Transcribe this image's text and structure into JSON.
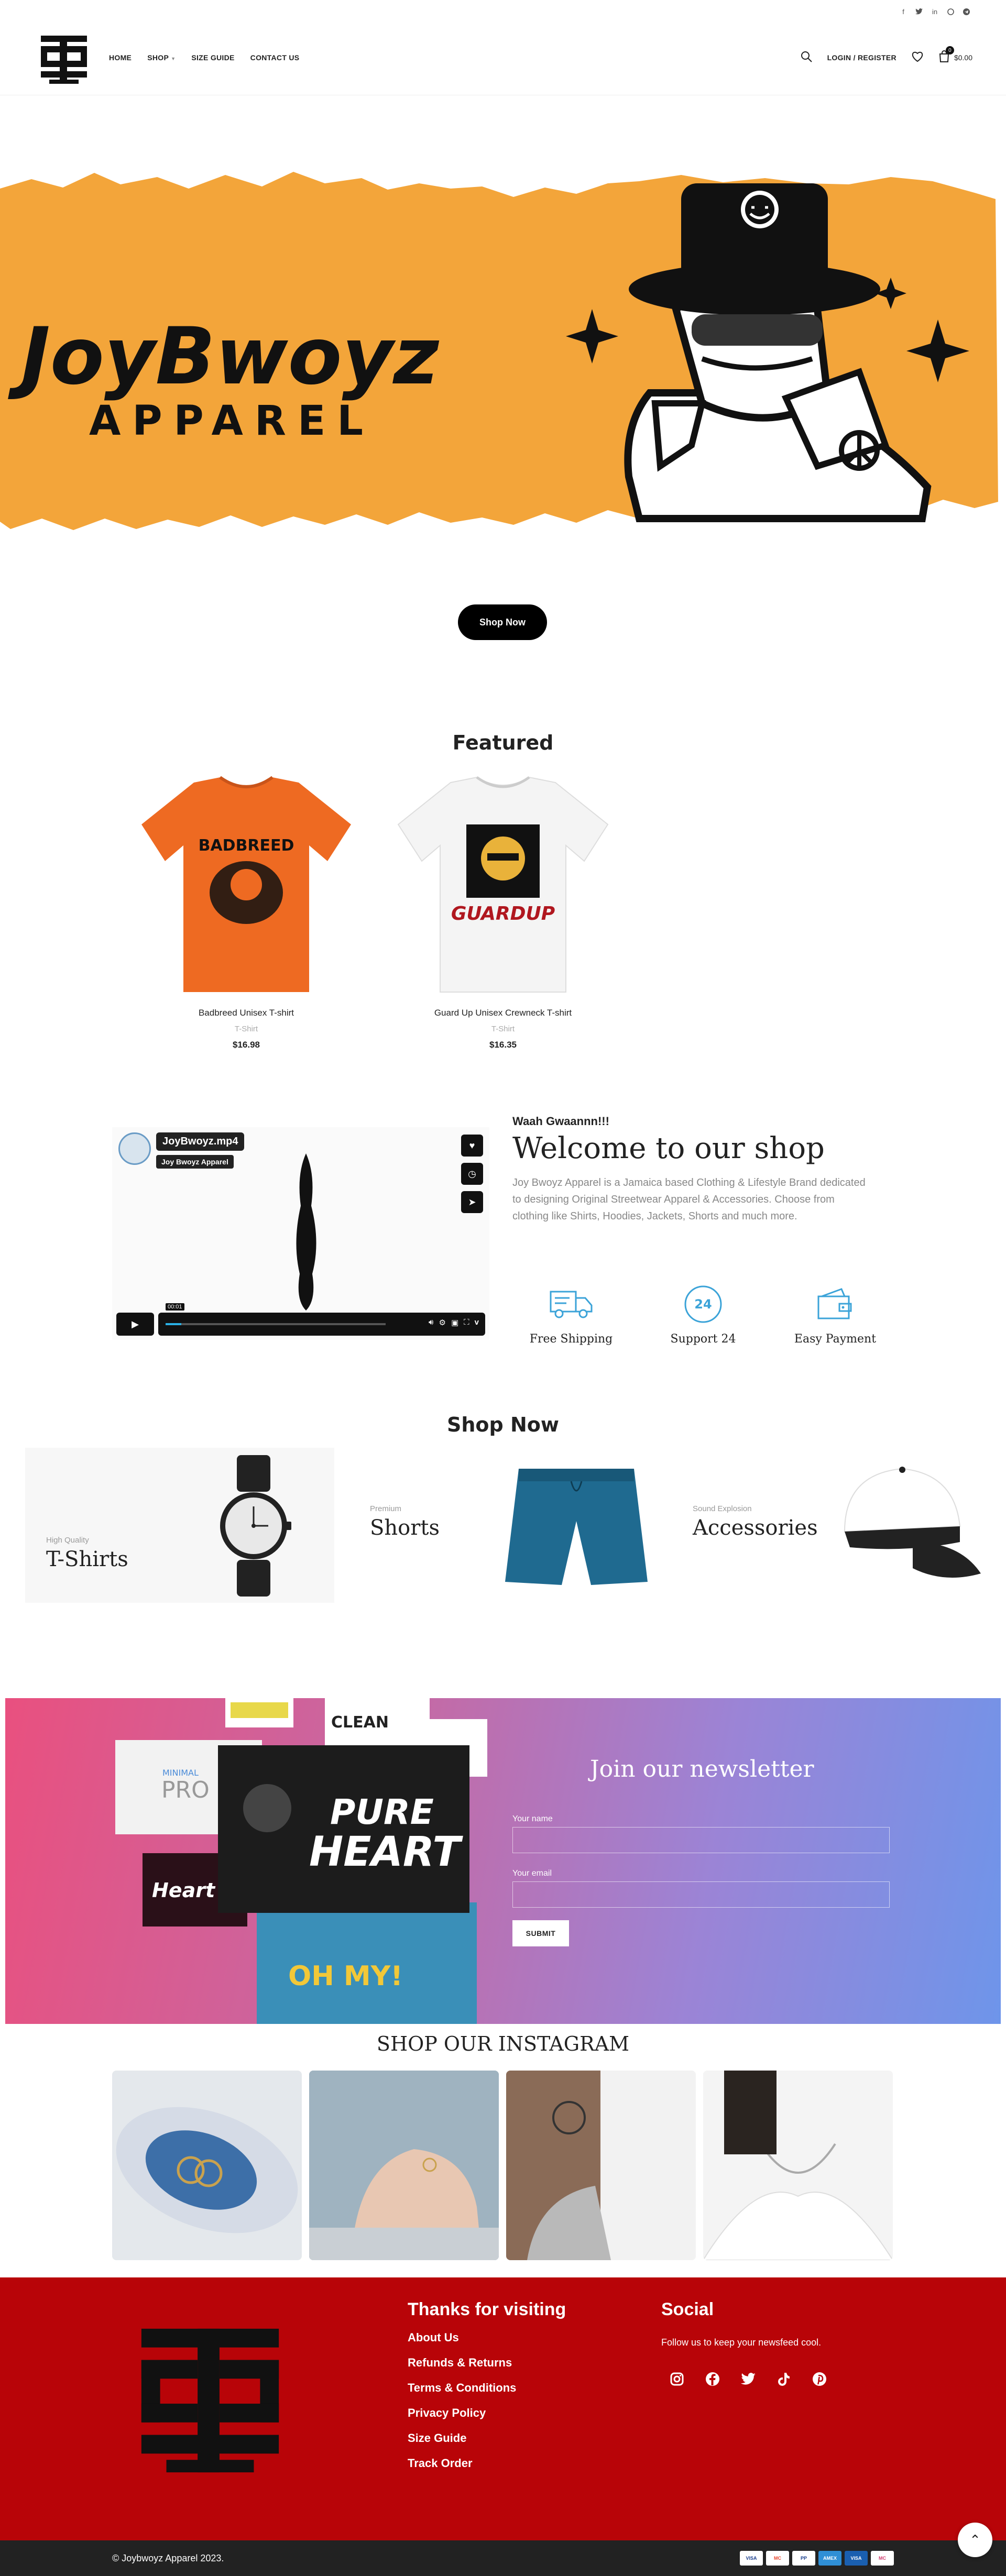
{
  "top_social": [
    "f",
    "t",
    "in",
    "w",
    "tg"
  ],
  "header": {
    "nav": [
      {
        "label": "HOME"
      },
      {
        "label": "SHOP"
      },
      {
        "label": "SIZE GUIDE"
      },
      {
        "label": "CONTACT US"
      }
    ],
    "login_label": "LOGIN / REGISTER",
    "cart_count": "0",
    "cart_total": "$0.00"
  },
  "hero": {
    "brand_text": "JoyBwoyz",
    "sub_text": "APPAREL",
    "colors": {
      "orange": "#f3a53a",
      "ink": "#111111"
    }
  },
  "hero_button": "Shop Now",
  "featured": {
    "title": "Featured",
    "products": [
      {
        "name": "Badbreed Unisex T-shirt",
        "category": "T-Shirt",
        "price": "$16.98",
        "shirt_color": "#ee6a22",
        "graphic_text": "BADBREED"
      },
      {
        "name": "Guard Up Unisex Crewneck T-shirt",
        "category": "T-Shirt",
        "price": "$16.35",
        "shirt_color": "#f4f4f4",
        "graphic_text": "GUARDUP"
      }
    ]
  },
  "video": {
    "title": "JoyBwoyz.mp4",
    "by": "Joy Bwoyz Apparel",
    "time": "00:01"
  },
  "welcome": {
    "small": "Waah Gwaannn!!!",
    "title": "Welcome to our shop",
    "text": "Joy Bwoyz Apparel is a Jamaica based Clothing & Lifestyle Brand dedicated to designing Original Streetwear Apparel & Accessories. Choose from clothing like Shirts, Hoodies, Jackets, Shorts and much more."
  },
  "features": [
    {
      "label": "Free Shipping",
      "icon": "truck-icon"
    },
    {
      "label": "Support 24",
      "icon": "support-24-icon"
    },
    {
      "label": "Easy Payment",
      "icon": "wallet-icon"
    }
  ],
  "shop_now": {
    "title": "Shop Now",
    "categories": [
      {
        "sub": "High Quality",
        "title": "T-Shirts"
      },
      {
        "sub": "Premium",
        "title": "Shorts"
      },
      {
        "sub": "Sound Explosion",
        "title": "Accessories"
      }
    ]
  },
  "newsletter": {
    "title": "Join our newsletter",
    "name_label": "Your name",
    "email_label": "Your email",
    "submit": "SUBMIT",
    "collage": {
      "pure": "PURE",
      "heart": "HEART",
      "clean": "CLEAN",
      "minimal": "MINIMAL",
      "pro": "PRO",
      "ohmy": "OH MY!",
      "heart2": "Heart"
    }
  },
  "instagram": {
    "title": "SHOP OUR INSTAGRAM"
  },
  "footer": {
    "visiting_title": "Thanks for visiting",
    "links": [
      "About Us",
      "Refunds & Returns",
      "Terms & Conditions",
      "Privacy Policy",
      "Size Guide",
      "Track Order"
    ],
    "social_title": "Social",
    "social_text": "Follow us to keep your newsfeed cool.",
    "social_icons": [
      "instagram-icon",
      "facebook-icon",
      "twitter-icon",
      "tiktok-icon",
      "pinterest-icon"
    ],
    "bg": "#b80408"
  },
  "bottom": {
    "copyright": "© Joybwoyz Apparel 2023.",
    "payments": [
      "VISA",
      "MC",
      "PP",
      "AMEX",
      "VISA",
      "MC"
    ]
  }
}
